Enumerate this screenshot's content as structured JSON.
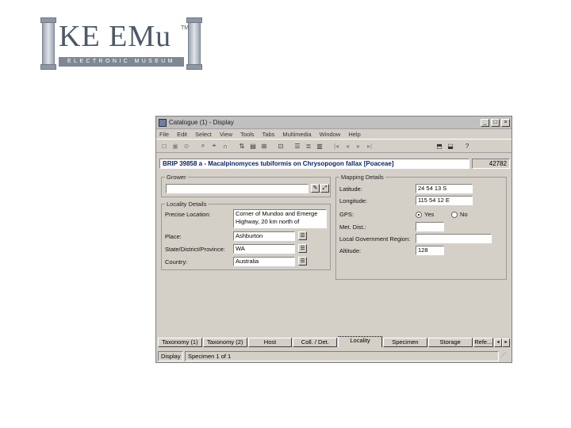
{
  "logo": {
    "brand": "KE EMu",
    "tm": "TM",
    "tagline": "ELECTRONIC MUSEUM"
  },
  "window": {
    "title": "Catalogue (1) - Display",
    "buttons": {
      "minimize": "_",
      "maximize": "□",
      "close": "×"
    },
    "menu": [
      "File",
      "Edit",
      "Select",
      "View",
      "Tools",
      "Tabs",
      "Multimedia",
      "Window",
      "Help"
    ],
    "record_title": "BRIP 39858 a - Macalpinomyces tubiformis on Chrysopogon fallax [Poaceae]",
    "record_number": "42782"
  },
  "grower": {
    "legend": "Grower",
    "value": ""
  },
  "locality": {
    "legend": "Locality Details",
    "precise_location_label": "Precise Location:",
    "precise_location_value_1": "Corner of Mundoo and Emerge",
    "precise_location_value_2": "Highway, 20 km north of",
    "place_label": "Place:",
    "place_value": "Ashburton",
    "state_label": "State/District/Province:",
    "state_value": "WA",
    "country_label": "Country:",
    "country_value": "Australia"
  },
  "mapping": {
    "legend": "Mapping Details",
    "latitude_label": "Latitude:",
    "latitude_value": "24 54 13 S",
    "longitude_label": "Longitude:",
    "longitude_value": "115 54 12 E",
    "gps_label": "GPS:",
    "gps_yes": "Yes",
    "gps_no": "No",
    "gps_selected": "Yes",
    "met_dist_label": "Met. Dist.:",
    "lga_label": "Local Government Region:",
    "altitude_label": "Altitude:",
    "altitude_value": "128"
  },
  "tabs": [
    "Taxonomy (1)",
    "Taxonomy (2)",
    "Host",
    "Coll. / Det.",
    "Locality",
    "Specimen",
    "Storage",
    "Refe..."
  ],
  "active_tab": "Locality",
  "status": {
    "mode": "Display",
    "record": "Specimen 1 of 1"
  }
}
